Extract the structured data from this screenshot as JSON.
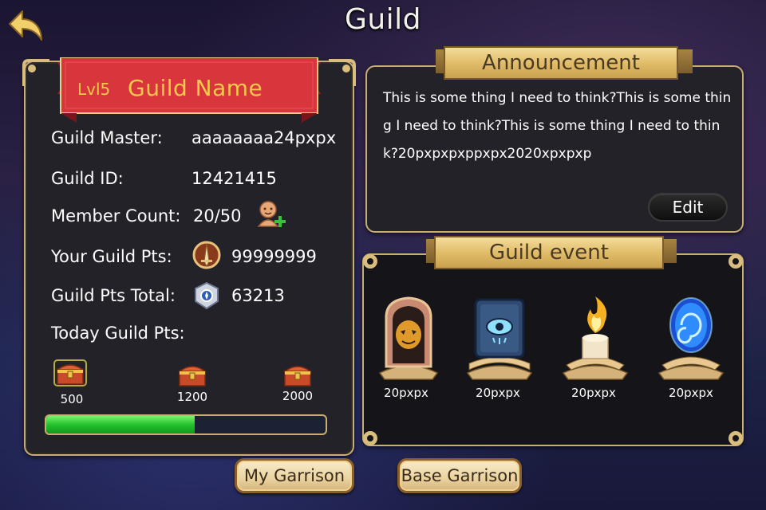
{
  "header": {
    "title": "Guild"
  },
  "guild": {
    "level": "Lvl5",
    "name": "Guild Name",
    "master_label": "Guild Master:",
    "master_value": "aaaaaaaa24pxpx",
    "id_label": "Guild ID:",
    "id_value": "12421415",
    "member_label": "Member Count:",
    "member_value": "20/50",
    "your_pts_label": "Your Guild Pts:",
    "your_pts_value": "99999999",
    "total_pts_label": "Guild Pts Total:",
    "total_pts_value": "63213",
    "today_label": "Today Guild Pts:",
    "chests": [
      {
        "label": "500"
      },
      {
        "label": "1200"
      },
      {
        "label": "2000"
      }
    ],
    "progress_fraction": 0.53
  },
  "announcement": {
    "title": "Announcement",
    "text": "This is some thing I need to think?This is some thing I need to think?This is some thing I need to think?20pxpxpxppxpx2020xpxpxp",
    "edit_label": "Edit"
  },
  "events": {
    "title": "Guild event",
    "items": [
      {
        "label": "20pxpx",
        "icon": "mask-shrine-icon"
      },
      {
        "label": "20pxpx",
        "icon": "eye-book-icon"
      },
      {
        "label": "20pxpx",
        "icon": "candle-flame-icon"
      },
      {
        "label": "20pxpx",
        "icon": "blue-portal-icon"
      }
    ]
  },
  "buttons": {
    "my_garrison": "My Garrison",
    "base_garrison": "Base Garrison"
  },
  "colors": {
    "gold": "#c9ad74",
    "ribbon_red": "#d8353d",
    "name_yellow": "#f6c94a",
    "progress_green": "#23c12d"
  }
}
